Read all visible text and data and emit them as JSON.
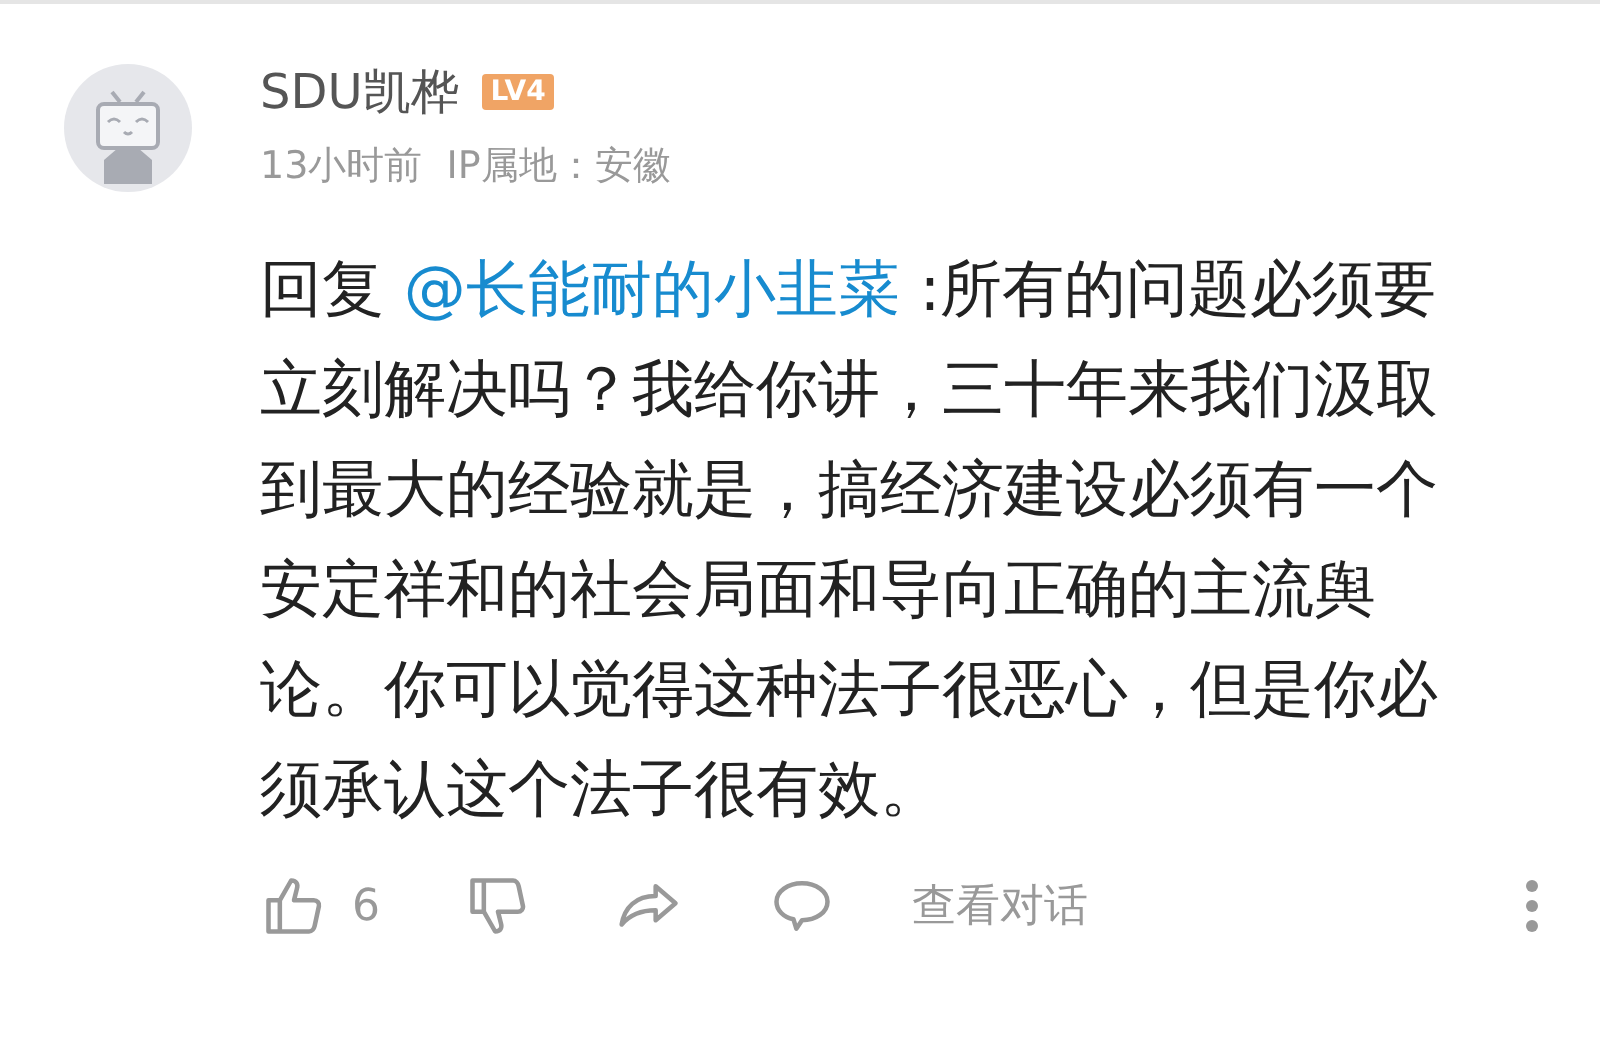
{
  "comment": {
    "user": "SDU凯桦",
    "level_badge": "LV4",
    "meta": "13小时前  IP属地：安徽",
    "reply_prefix": "回复",
    "mention": "@长能耐的小韭菜",
    "text": ":所有的问题必须要立刻解决吗？我给你讲，三十年来我们汲取到最大的经验就是，搞经济建设必须有一个安定祥和的社会局面和导向正确的主流舆论。你可以觉得这种法子很恶心，但是你必须承认这个法子很有效。"
  },
  "actions": {
    "likes": "6",
    "view_dialog": "查看对话"
  }
}
